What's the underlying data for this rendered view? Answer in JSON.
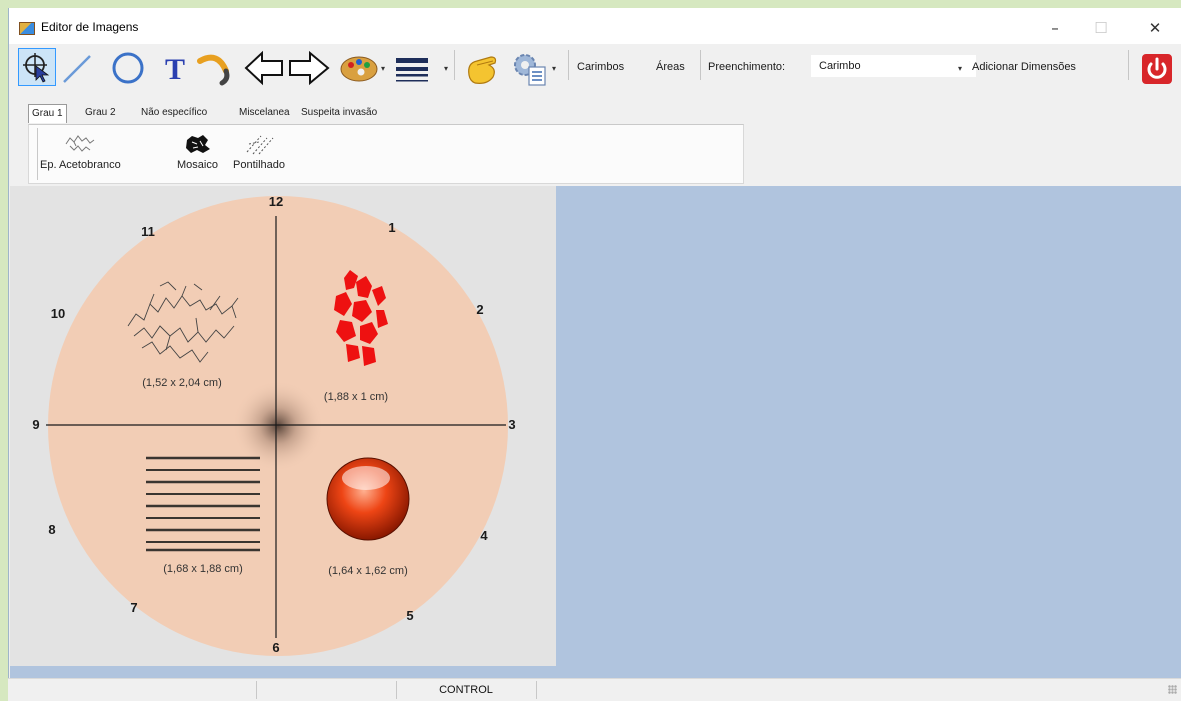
{
  "window": {
    "title": "Editor de Imagens",
    "controls": {
      "minimize": "–",
      "maximize": "☐",
      "close": "✕"
    }
  },
  "toolbar": {
    "labels": {
      "carimbos": "Carimbos",
      "areas": "Áreas",
      "preenchimento": "Preenchimento:",
      "adicionar": "Adicionar Dimensões"
    },
    "fill_combo": {
      "value": "Carimbo"
    },
    "icons": [
      "select-icon",
      "line-icon",
      "circle-icon",
      "text-icon",
      "curve-icon",
      "double-arrow-icon",
      "palette-icon",
      "line-weight-icon",
      "hand-icon",
      "settings-icon",
      "power-icon"
    ]
  },
  "tabs": [
    {
      "label": "Grau 1",
      "active": true
    },
    {
      "label": "Grau 2",
      "active": false
    },
    {
      "label": "Não específico",
      "active": false
    },
    {
      "label": "Miscelanea",
      "active": false
    },
    {
      "label": "Suspeita invasão",
      "active": false
    }
  ],
  "stamps": [
    {
      "label": "Ep. Acetobranco"
    },
    {
      "label": "Mosaico"
    },
    {
      "label": "Pontilhado"
    }
  ],
  "clock": {
    "n12": "12",
    "n1": "1",
    "n2": "2",
    "n3": "3",
    "n4": "4",
    "n5": "5",
    "n6": "6",
    "n7": "7",
    "n8": "8",
    "n9": "9",
    "n10": "10",
    "n11": "11"
  },
  "lesions": {
    "acetobranco": "(1,52 x 2,04 cm)",
    "mosaico": "(1,88 x 1 cm)",
    "pontilhado": "(1,68 x 1,88 cm)",
    "sphere": "(1,64 x 1,62 cm)"
  },
  "statusbar": {
    "mode": "CONTROL"
  },
  "colors": {
    "canvas_bg": "#b0c4de",
    "cervix": "#f2cdb5",
    "mosaic_red": "#ee1111",
    "sphere_red": "#e03010",
    "power_red": "#d8262a"
  }
}
